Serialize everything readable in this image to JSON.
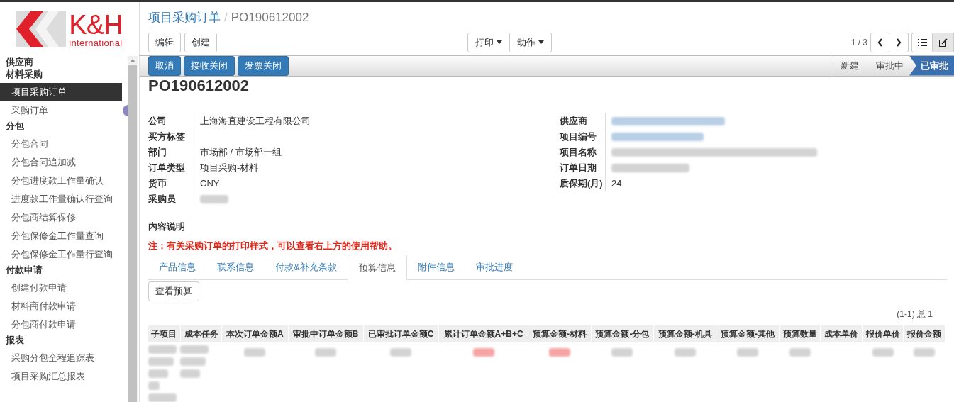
{
  "logo": {
    "brand": "K&H",
    "sub": "international"
  },
  "sidebar": {
    "sections": [
      {
        "title": "供应商"
      },
      {
        "title": "材料采购",
        "items": [
          {
            "label": "项目采购订单",
            "selected": true,
            "badge": false
          },
          {
            "label": "采购订单",
            "selected": false,
            "badge": true
          }
        ]
      },
      {
        "title": "分包",
        "items": [
          {
            "label": "分包合同",
            "selected": false,
            "badge": false
          },
          {
            "label": "分包合同追加减",
            "selected": false,
            "badge": false
          },
          {
            "label": "分包进度款工作量确认",
            "selected": false,
            "badge": false
          },
          {
            "label": "进度款工作量确认行查询",
            "selected": false,
            "badge": false
          },
          {
            "label": "分包商结算保修",
            "selected": false,
            "badge": false
          },
          {
            "label": "分包保修金工作量查询",
            "selected": false,
            "badge": false
          },
          {
            "label": "分包保修金工作量行查询",
            "selected": false,
            "badge": false
          }
        ]
      },
      {
        "title": "付款申请",
        "items": [
          {
            "label": "创建付款申请",
            "selected": false,
            "badge": false
          },
          {
            "label": "材料商付款申请",
            "selected": false,
            "badge": false
          },
          {
            "label": "分包商付款申请",
            "selected": false,
            "badge": false
          }
        ]
      },
      {
        "title": "报表",
        "items": [
          {
            "label": "采购分包全程追踪表",
            "selected": false,
            "badge": false
          },
          {
            "label": "项目采购汇总报表",
            "selected": false,
            "badge": false
          }
        ]
      }
    ]
  },
  "breadcrumb": {
    "parent": "项目采购订单",
    "separator": "/",
    "current": "PO190612002"
  },
  "toolbar": {
    "buttons": [
      "编辑",
      "创建"
    ],
    "dropdowns": [
      "打印",
      "动作"
    ],
    "pager": "1 / 3",
    "views": [
      {
        "kind": "list",
        "selected": false
      },
      {
        "kind": "form",
        "selected": true
      }
    ]
  },
  "actions": [
    "取消",
    "接收关闭",
    "发票关闭"
  ],
  "stages": [
    {
      "label": "新建",
      "selected": false
    },
    {
      "label": "审批中",
      "selected": false
    },
    {
      "label": "已审批",
      "selected": true
    }
  ],
  "title": "PO190612002",
  "left_fields": [
    {
      "label": "公司",
      "value": "上海海直建设工程有限公司",
      "redacted": false
    },
    {
      "label": "买方标签",
      "redacted": false
    },
    {
      "label": "部门",
      "value": "市场部 / 市场部一组",
      "redacted": false
    },
    {
      "label": "订单类型",
      "value": "项目采购-材料",
      "redacted": false
    },
    {
      "label": "货币",
      "value": "CNY",
      "redacted": false
    },
    {
      "label": "采购员",
      "redacted": true
    }
  ],
  "right_fields": [
    {
      "label": "供应商",
      "redacted": true
    },
    {
      "label": "项目编号",
      "redacted": true
    },
    {
      "label": "项目名称",
      "redacted": true
    },
    {
      "label": "订单日期",
      "redacted": true
    },
    {
      "label": "质保期(月)",
      "value": "24",
      "redacted": false
    }
  ],
  "description": {
    "label": "内容说明"
  },
  "note": "注：有关采购订单的打印样式，可以查看右上方的使用帮助。",
  "tabs": [
    {
      "label": "产品信息",
      "selected": false
    },
    {
      "label": "联系信息",
      "selected": false
    },
    {
      "label": "付款&补充条款",
      "selected": false
    },
    {
      "label": "预算信息",
      "selected": true
    },
    {
      "label": "附件信息",
      "selected": false
    },
    {
      "label": "审批进度",
      "selected": false
    }
  ],
  "budget_button": "查看预算",
  "table": {
    "pager": "(1-1) 总 1",
    "columns": [
      "子项目",
      "成本任务",
      "本次订单金额A",
      "审批中订单金额B",
      "已审批订单金额C",
      "累计订单金额A+B+C",
      "预算金额-材料",
      "预算金额-分包",
      "预算金额-机具",
      "预算金额-其他",
      "预算数量",
      "成本单价",
      "报价单价",
      "报价金额"
    ],
    "rows": [
      {
        "cells": [
          {
            "kind": "blurred",
            "alert": false
          },
          {
            "kind": "blurred",
            "alert": false
          },
          {
            "kind": "blurred",
            "alert": false
          },
          {
            "kind": "blurred",
            "alert": false
          },
          {
            "kind": "blurred",
            "alert": false
          },
          {
            "kind": "blurred",
            "alert": true
          },
          {
            "kind": "blurred",
            "alert": true
          },
          {
            "kind": "blurred",
            "alert": false
          },
          {
            "kind": "blurred",
            "alert": false
          },
          {
            "kind": "blurred",
            "alert": false
          },
          {
            "kind": "blurred",
            "alert": false
          },
          {
            "kind": "empty"
          },
          {
            "kind": "blurred",
            "alert": false
          },
          {
            "kind": "blurred",
            "alert": false
          }
        ]
      }
    ]
  }
}
